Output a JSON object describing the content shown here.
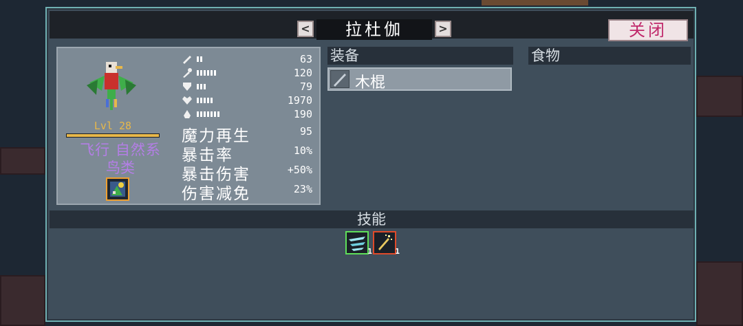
{
  "window": {
    "title": "拉杜伽",
    "prev_label": "<",
    "next_label": ">",
    "close_label": "关闭"
  },
  "creature": {
    "level": "Lvl 28",
    "xp_fraction": 1.0,
    "type_line1": "飞行 自然系",
    "type_line2": "鸟类",
    "trait_icon": "nature-trait-icon"
  },
  "stats": [
    {
      "icon": "sword-icon",
      "pips": 2,
      "value": "63"
    },
    {
      "icon": "wand-icon",
      "pips": 6,
      "value": "120"
    },
    {
      "icon": "shield-icon",
      "pips": 3,
      "value": "79"
    },
    {
      "icon": "heart-icon",
      "pips": 5,
      "value": "1970"
    },
    {
      "icon": "mana-icon",
      "pips": 7,
      "value": "190"
    }
  ],
  "secondary_stats": [
    {
      "label": "魔力再生",
      "value": "95"
    },
    {
      "label": "暴击率",
      "value": "10%"
    },
    {
      "label": "暴击伤害",
      "value": "+50%"
    },
    {
      "label": "伤害减免",
      "value": "23%"
    }
  ],
  "equipment": {
    "header": "装备",
    "item_name": "木棍",
    "item_icon": "staff-icon"
  },
  "food": {
    "header": "食物"
  },
  "skills": {
    "header": "技能",
    "items": [
      {
        "icon": "wind-slash-icon",
        "count": "1",
        "border": "#5fe05a"
      },
      {
        "icon": "spark-icon",
        "count": "1",
        "border": "#e04a2a"
      }
    ]
  },
  "colors": {
    "panel_bg": "#3f4e5b",
    "panel_border": "#6fb0b3",
    "level": "#e8b84a",
    "type_text": "#b47ee6",
    "close_text": "#c0286a"
  }
}
